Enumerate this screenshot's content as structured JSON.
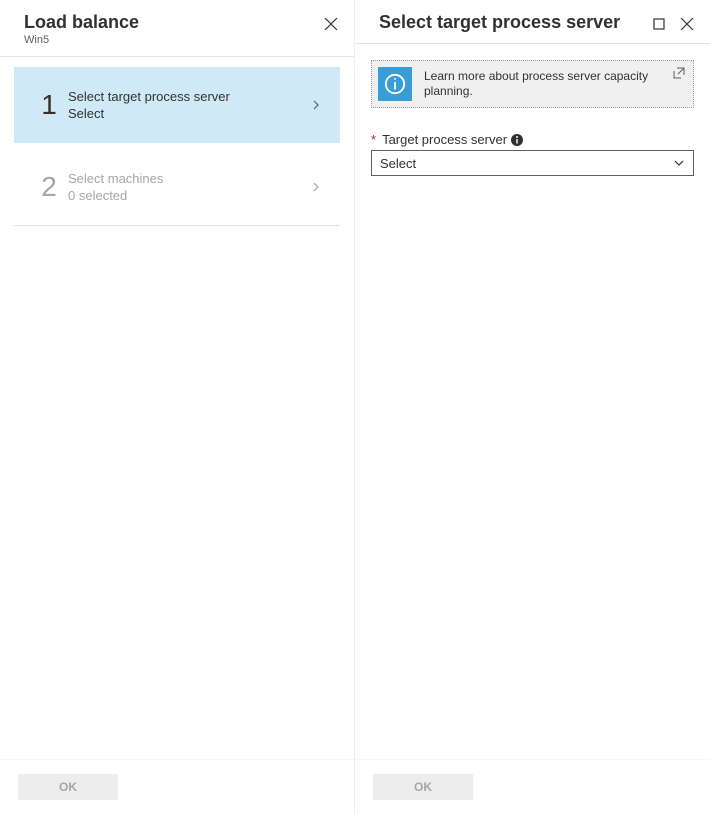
{
  "left": {
    "title": "Load balance",
    "subtitle": "Win5",
    "steps": [
      {
        "num": "1",
        "title": "Select target process server",
        "sub": "Select",
        "active": true
      },
      {
        "num": "2",
        "title": "Select machines",
        "sub": "0 selected",
        "active": false
      }
    ],
    "ok": "OK"
  },
  "right": {
    "title": "Select target process server",
    "banner": "Learn more about process server capacity planning.",
    "field_label": "Target process server",
    "dropdown_value": "Select",
    "ok": "OK"
  }
}
